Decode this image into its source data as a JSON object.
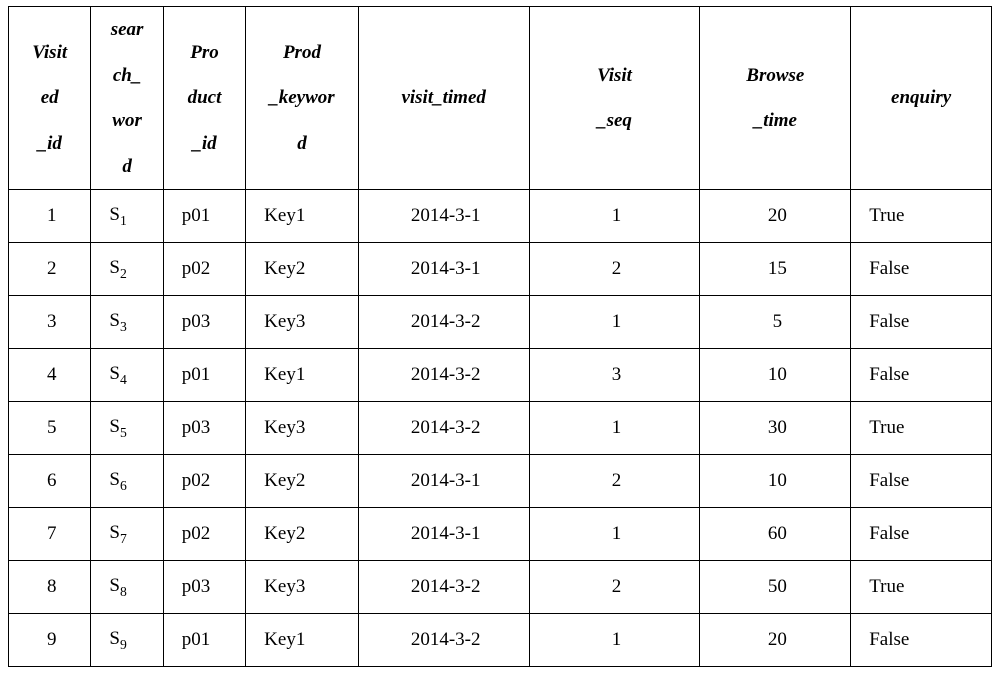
{
  "chart_data": {
    "type": "table",
    "title": "",
    "columns": [
      "Visited_id",
      "search_word",
      "Product_id",
      "Prod_keyword",
      "visit_timed",
      "Visit_seq",
      "Browse_time",
      "enquiry"
    ],
    "rows": [
      {
        "visited_id": "1",
        "search_word": "S1",
        "product_id": "p01",
        "prod_keyword": "Key1",
        "visit_timed": "2014-3-1",
        "visit_seq": "1",
        "browse_time": "20",
        "enquiry": "True"
      },
      {
        "visited_id": "2",
        "search_word": "S2",
        "product_id": "p02",
        "prod_keyword": "Key2",
        "visit_timed": "2014-3-1",
        "visit_seq": "2",
        "browse_time": "15",
        "enquiry": "False"
      },
      {
        "visited_id": "3",
        "search_word": "S3",
        "product_id": "p03",
        "prod_keyword": "Key3",
        "visit_timed": "2014-3-2",
        "visit_seq": "1",
        "browse_time": "5",
        "enquiry": "False"
      },
      {
        "visited_id": "4",
        "search_word": "S4",
        "product_id": "p01",
        "prod_keyword": "Key1",
        "visit_timed": "2014-3-2",
        "visit_seq": "3",
        "browse_time": "10",
        "enquiry": "False"
      },
      {
        "visited_id": "5",
        "search_word": "S5",
        "product_id": "p03",
        "prod_keyword": "Key3",
        "visit_timed": "2014-3-2",
        "visit_seq": "1",
        "browse_time": "30",
        "enquiry": "True"
      },
      {
        "visited_id": "6",
        "search_word": "S6",
        "product_id": "p02",
        "prod_keyword": "Key2",
        "visit_timed": "2014-3-1",
        "visit_seq": "2",
        "browse_time": "10",
        "enquiry": "False"
      },
      {
        "visited_id": "7",
        "search_word": "S7",
        "product_id": "p02",
        "prod_keyword": "Key2",
        "visit_timed": "2014-3-1",
        "visit_seq": "1",
        "browse_time": "60",
        "enquiry": "False"
      },
      {
        "visited_id": "8",
        "search_word": "S8",
        "product_id": "p03",
        "prod_keyword": "Key3",
        "visit_timed": "2014-3-2",
        "visit_seq": "2",
        "browse_time": "50",
        "enquiry": "True"
      },
      {
        "visited_id": "9",
        "search_word": "S9",
        "product_id": "p01",
        "prod_keyword": "Key1",
        "visit_timed": "2014-3-2",
        "visit_seq": "1",
        "browse_time": "20",
        "enquiry": "False"
      }
    ]
  },
  "headers": {
    "visited_id": "Visit\ned\n_id",
    "search_word": "sear\nch_\nwor\nd",
    "product_id": "Pro\nduct\n_id",
    "prod_keyword": "Prod\n_keywor\nd",
    "visit_timed": "visit_timed",
    "visit_seq": "Visit\n_seq",
    "browse_time": "Browse\n_time",
    "enquiry": "enquiry"
  }
}
